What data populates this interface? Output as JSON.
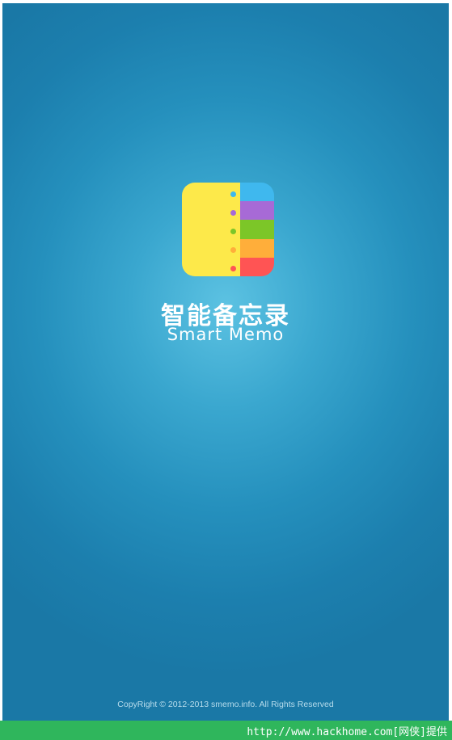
{
  "app": {
    "title_cn": "智能备忘录",
    "title_en": "Smart Memo",
    "copyright": "CopyRight © 2012-2013 smemo.info. All Rights Reserved"
  },
  "logo": {
    "icon_name": "notebook-icon",
    "left_color": "#fde94a",
    "stripe_colors": [
      "#3fb8ee",
      "#a76ad6",
      "#7cc628",
      "#ffae3a",
      "#ff5454"
    ],
    "dot_colors": [
      "#3fb8ee",
      "#a76ad6",
      "#7cc628",
      "#ffae3a",
      "#ff5454"
    ]
  },
  "watermark": {
    "text": "http://www.hackhome.com[网侠]提供",
    "bar_color": "#2fb65c"
  },
  "colors": {
    "background_center": "#5cc2e2",
    "background_edge": "#1a78a6",
    "text": "#ffffff"
  }
}
